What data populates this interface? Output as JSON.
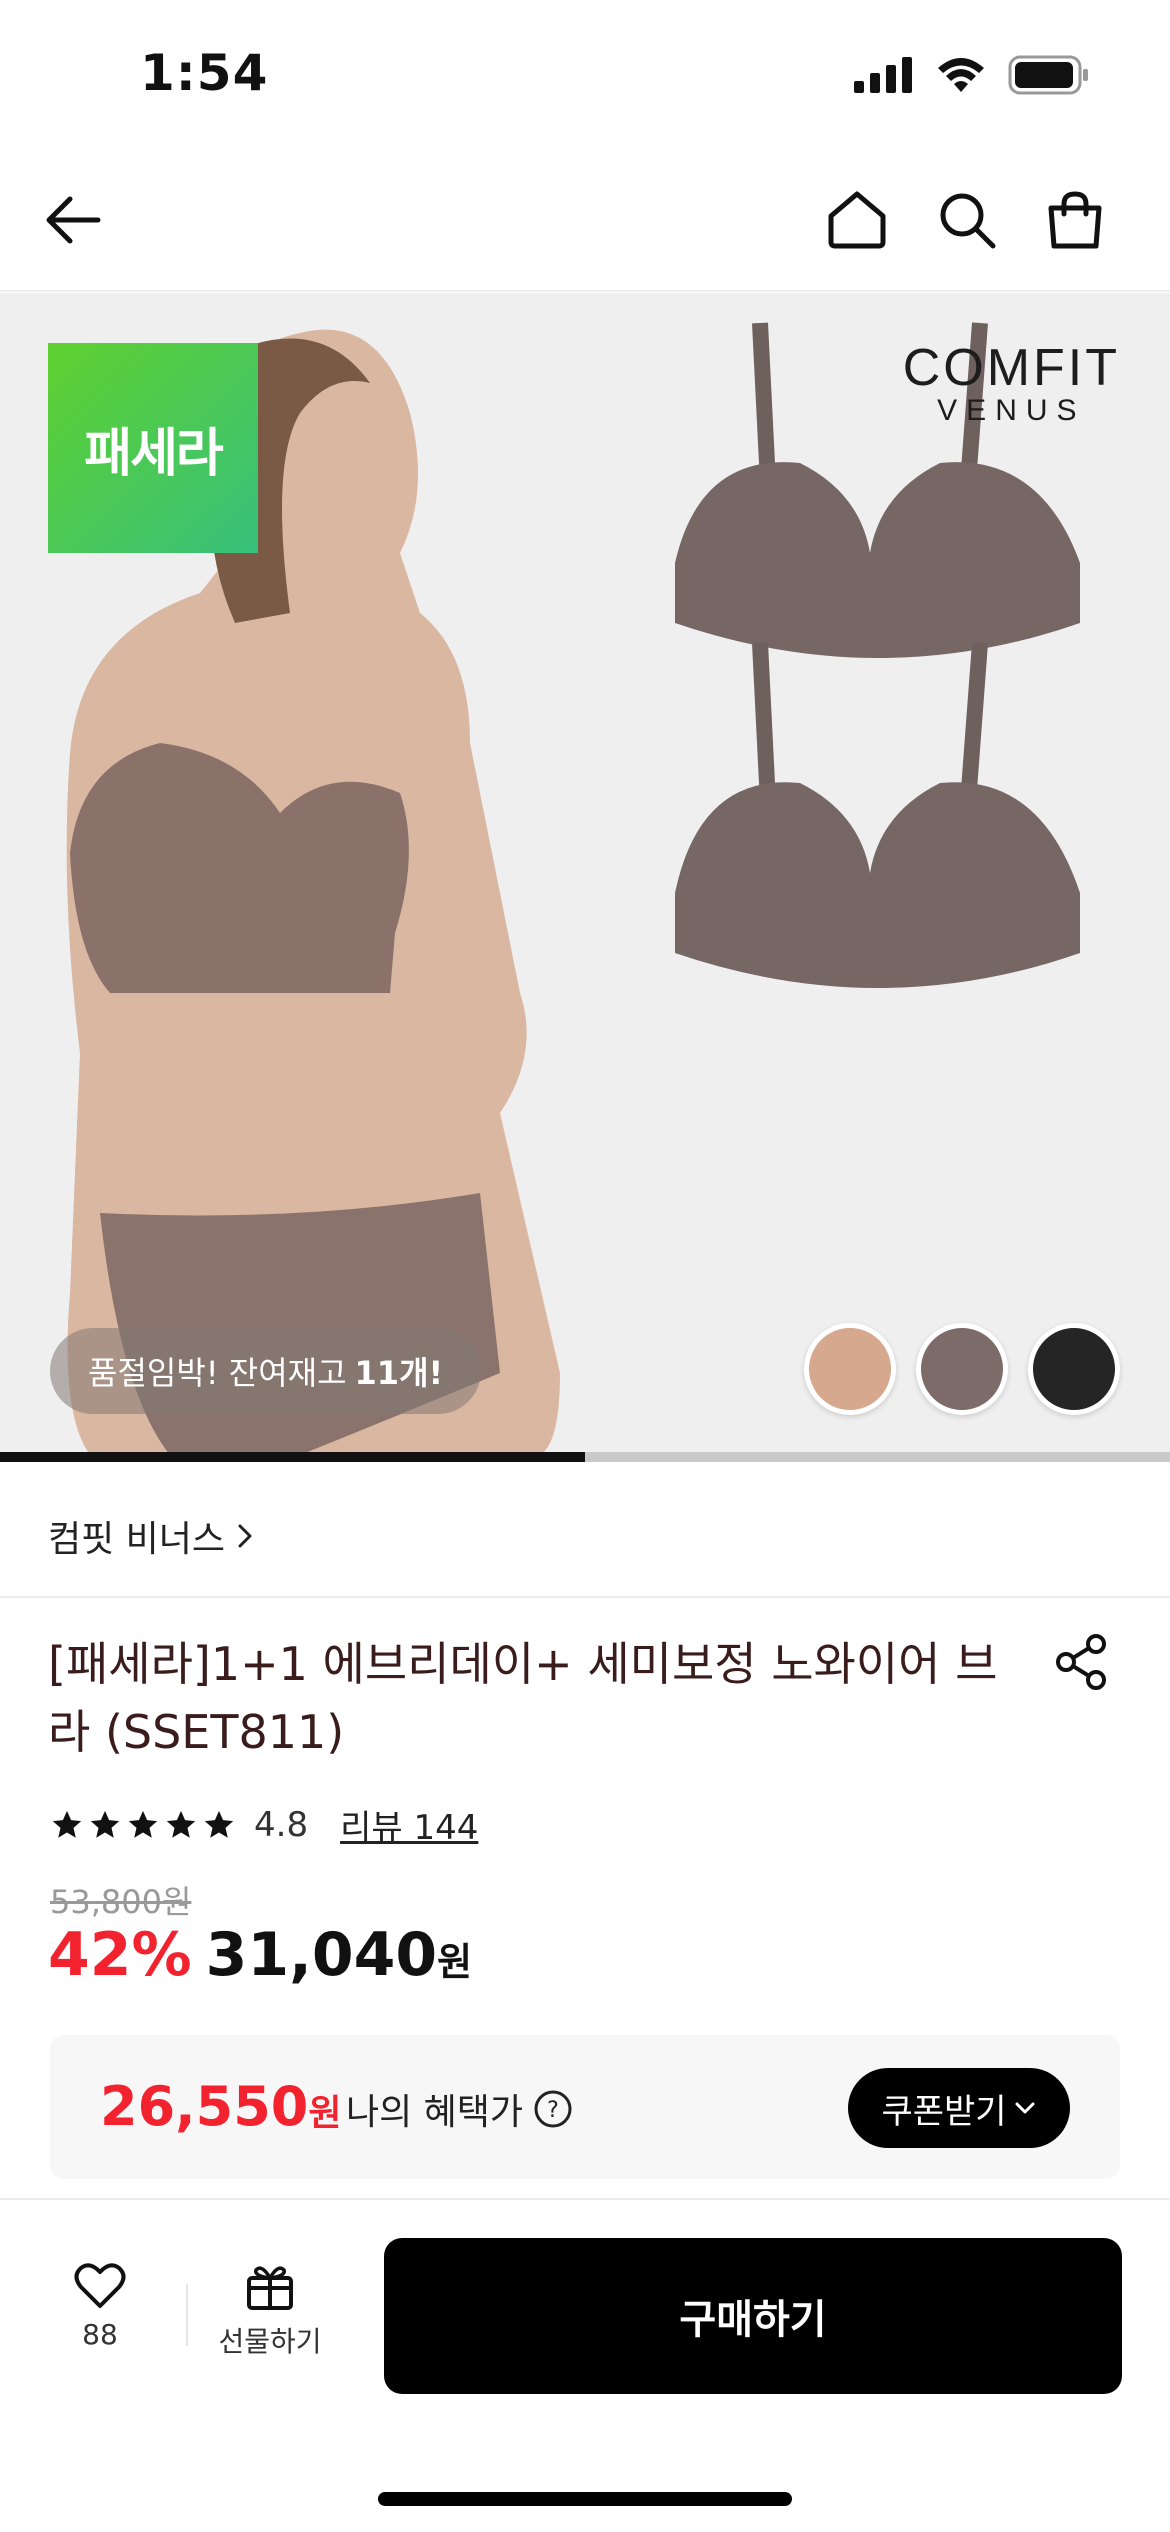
{
  "status_bar": {
    "time": "1:54"
  },
  "hero": {
    "brand_tag": "패세라",
    "logo_line1": "COMFIT",
    "logo_line2": "VENUS",
    "stock_text": "품절임박! 잔여재고",
    "stock_count": "11개!",
    "swatch_colors": [
      "#d6a98e",
      "#7c6b68",
      "#252525"
    ],
    "gallery_progress_fraction": 0.5
  },
  "product": {
    "brand": "컴핏 비너스",
    "title": "[패세라]1+1 에브리데이+ 세미보정 노와이어 브라 (SSET811)",
    "rating": "4.8",
    "star_count": 5,
    "review_link": "리뷰 144",
    "original_price": "53,800원",
    "discount": "42%",
    "price": "31,040",
    "price_unit": "원"
  },
  "benefit": {
    "price": "26,550",
    "unit": "원",
    "label": "나의 혜택가",
    "coupon_button": "쿠폰받기"
  },
  "bottom_bar": {
    "like_count": "88",
    "gift_label": "선물하기",
    "buy_label": "구매하기"
  },
  "colors": {
    "accent_red": "#f2222e",
    "brand_green": "#4cc45a"
  }
}
